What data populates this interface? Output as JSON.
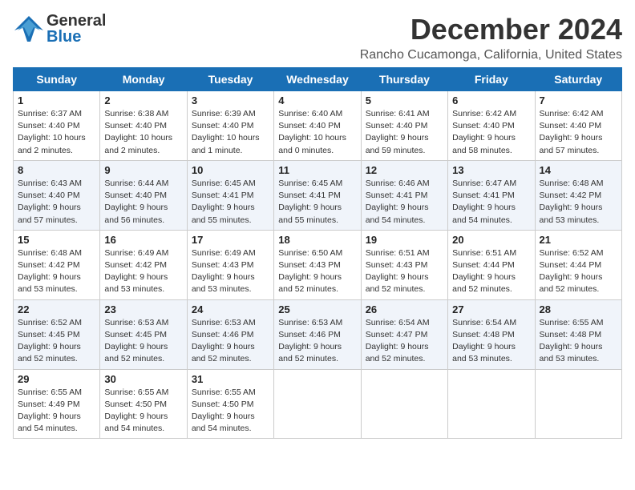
{
  "header": {
    "logo_general": "General",
    "logo_blue": "Blue",
    "title": "December 2024",
    "subtitle": "Rancho Cucamonga, California, United States"
  },
  "calendar": {
    "days_of_week": [
      "Sunday",
      "Monday",
      "Tuesday",
      "Wednesday",
      "Thursday",
      "Friday",
      "Saturday"
    ],
    "weeks": [
      [
        null,
        null,
        null,
        null,
        null,
        null,
        null
      ]
    ]
  },
  "cells": {
    "w1": [
      {
        "day": "1",
        "content": "Sunrise: 6:37 AM\nSunset: 4:40 PM\nDaylight: 10 hours\nand 2 minutes."
      },
      {
        "day": "2",
        "content": "Sunrise: 6:38 AM\nSunset: 4:40 PM\nDaylight: 10 hours\nand 2 minutes."
      },
      {
        "day": "3",
        "content": "Sunrise: 6:39 AM\nSunset: 4:40 PM\nDaylight: 10 hours\nand 1 minute."
      },
      {
        "day": "4",
        "content": "Sunrise: 6:40 AM\nSunset: 4:40 PM\nDaylight: 10 hours\nand 0 minutes."
      },
      {
        "day": "5",
        "content": "Sunrise: 6:41 AM\nSunset: 4:40 PM\nDaylight: 9 hours\nand 59 minutes."
      },
      {
        "day": "6",
        "content": "Sunrise: 6:42 AM\nSunset: 4:40 PM\nDaylight: 9 hours\nand 58 minutes."
      },
      {
        "day": "7",
        "content": "Sunrise: 6:42 AM\nSunset: 4:40 PM\nDaylight: 9 hours\nand 57 minutes."
      }
    ],
    "w2": [
      {
        "day": "8",
        "content": "Sunrise: 6:43 AM\nSunset: 4:40 PM\nDaylight: 9 hours\nand 57 minutes."
      },
      {
        "day": "9",
        "content": "Sunrise: 6:44 AM\nSunset: 4:40 PM\nDaylight: 9 hours\nand 56 minutes."
      },
      {
        "day": "10",
        "content": "Sunrise: 6:45 AM\nSunset: 4:41 PM\nDaylight: 9 hours\nand 55 minutes."
      },
      {
        "day": "11",
        "content": "Sunrise: 6:45 AM\nSunset: 4:41 PM\nDaylight: 9 hours\nand 55 minutes."
      },
      {
        "day": "12",
        "content": "Sunrise: 6:46 AM\nSunset: 4:41 PM\nDaylight: 9 hours\nand 54 minutes."
      },
      {
        "day": "13",
        "content": "Sunrise: 6:47 AM\nSunset: 4:41 PM\nDaylight: 9 hours\nand 54 minutes."
      },
      {
        "day": "14",
        "content": "Sunrise: 6:48 AM\nSunset: 4:42 PM\nDaylight: 9 hours\nand 53 minutes."
      }
    ],
    "w3": [
      {
        "day": "15",
        "content": "Sunrise: 6:48 AM\nSunset: 4:42 PM\nDaylight: 9 hours\nand 53 minutes."
      },
      {
        "day": "16",
        "content": "Sunrise: 6:49 AM\nSunset: 4:42 PM\nDaylight: 9 hours\nand 53 minutes."
      },
      {
        "day": "17",
        "content": "Sunrise: 6:49 AM\nSunset: 4:43 PM\nDaylight: 9 hours\nand 53 minutes."
      },
      {
        "day": "18",
        "content": "Sunrise: 6:50 AM\nSunset: 4:43 PM\nDaylight: 9 hours\nand 52 minutes."
      },
      {
        "day": "19",
        "content": "Sunrise: 6:51 AM\nSunset: 4:43 PM\nDaylight: 9 hours\nand 52 minutes."
      },
      {
        "day": "20",
        "content": "Sunrise: 6:51 AM\nSunset: 4:44 PM\nDaylight: 9 hours\nand 52 minutes."
      },
      {
        "day": "21",
        "content": "Sunrise: 6:52 AM\nSunset: 4:44 PM\nDaylight: 9 hours\nand 52 minutes."
      }
    ],
    "w4": [
      {
        "day": "22",
        "content": "Sunrise: 6:52 AM\nSunset: 4:45 PM\nDaylight: 9 hours\nand 52 minutes."
      },
      {
        "day": "23",
        "content": "Sunrise: 6:53 AM\nSunset: 4:45 PM\nDaylight: 9 hours\nand 52 minutes."
      },
      {
        "day": "24",
        "content": "Sunrise: 6:53 AM\nSunset: 4:46 PM\nDaylight: 9 hours\nand 52 minutes."
      },
      {
        "day": "25",
        "content": "Sunrise: 6:53 AM\nSunset: 4:46 PM\nDaylight: 9 hours\nand 52 minutes."
      },
      {
        "day": "26",
        "content": "Sunrise: 6:54 AM\nSunset: 4:47 PM\nDaylight: 9 hours\nand 52 minutes."
      },
      {
        "day": "27",
        "content": "Sunrise: 6:54 AM\nSunset: 4:48 PM\nDaylight: 9 hours\nand 53 minutes."
      },
      {
        "day": "28",
        "content": "Sunrise: 6:55 AM\nSunset: 4:48 PM\nDaylight: 9 hours\nand 53 minutes."
      }
    ],
    "w5": [
      {
        "day": "29",
        "content": "Sunrise: 6:55 AM\nSunset: 4:49 PM\nDaylight: 9 hours\nand 54 minutes."
      },
      {
        "day": "30",
        "content": "Sunrise: 6:55 AM\nSunset: 4:50 PM\nDaylight: 9 hours\nand 54 minutes."
      },
      {
        "day": "31",
        "content": "Sunrise: 6:55 AM\nSunset: 4:50 PM\nDaylight: 9 hours\nand 54 minutes."
      },
      null,
      null,
      null,
      null
    ]
  }
}
